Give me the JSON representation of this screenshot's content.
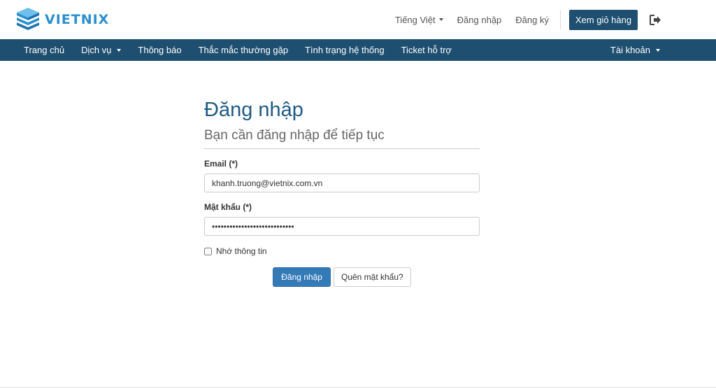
{
  "brand": {
    "name": "VIETNIX",
    "logo_icon": "stacked-cubes-logo-icon",
    "color": "#2a8fd1"
  },
  "header": {
    "language": "Tiếng Việt",
    "login": "Đăng nhập",
    "register": "Đăng ký",
    "cart_button": "Xem giỏ hàng",
    "logout_icon": "logout-icon"
  },
  "nav": {
    "items": [
      {
        "label": "Trang chủ"
      },
      {
        "label": "Dịch vụ"
      },
      {
        "label": "Thông báo"
      },
      {
        "label": "Thắc mắc thường gặp"
      },
      {
        "label": "Tình trạng hệ thống"
      },
      {
        "label": "Ticket hỗ trợ"
      }
    ],
    "account": "Tài khoản",
    "color": "#1e4f70"
  },
  "login_form": {
    "title": "Đăng nhập",
    "subtitle": "Bạn cần đăng nhập để tiếp tục",
    "email_label": "Email (*)",
    "email_value": "khanh.truong@vietnix.com.vn",
    "password_label": "Mật khẩu (*)",
    "password_value": "••••••••••••••••••••••••••••",
    "remember_label": "Nhớ thông tin",
    "submit_button": "Đăng nhập",
    "forgot_button": "Quên mật khẩu?",
    "accent": "#337ab7"
  }
}
